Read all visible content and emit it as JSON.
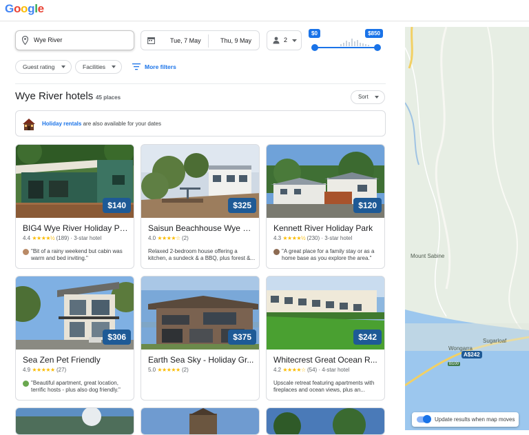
{
  "brand": {
    "logo_letters": [
      "G",
      "o",
      "o",
      "g",
      "l",
      "e"
    ]
  },
  "search": {
    "location": "Wye River",
    "check_in": "Tue, 7 May",
    "check_out": "Thu, 9 May",
    "guests": "2",
    "price_min": "$0",
    "price_max": "$850"
  },
  "filters": {
    "guest_rating": "Guest rating",
    "facilities": "Facilities",
    "more_filters": "More filters"
  },
  "results": {
    "title": "Wye River hotels",
    "count": "45 places",
    "sort_label": "Sort"
  },
  "banner": {
    "link": "Holiday rentals",
    "rest": " are also available for your dates"
  },
  "hotels": [
    {
      "name": "BIG4 Wye River Holiday Pa...",
      "rating": "4.4",
      "stars": "★★★★½",
      "reviews": "(189)",
      "type": " · 3-star hotel",
      "price": "$140",
      "desc": "\"Bit of a rainy weekend but cabin was warm and bed inviting.\"",
      "quote": true
    },
    {
      "name": "Saisun Beachhouse Wye Ri...",
      "rating": "4.0",
      "stars": "★★★★☆",
      "reviews": "(2)",
      "type": "",
      "price": "$325",
      "desc": "Relaxed 2-bedroom house offering a kitchen, a sundeck & a BBQ, plus forest &...",
      "quote": false
    },
    {
      "name": "Kennett River Holiday Park",
      "rating": "4.3",
      "stars": "★★★★½",
      "reviews": "(230)",
      "type": " · 3-star hotel",
      "price": "$120",
      "desc": "\"A great place for a family stay or as a home base as you explore the area.\"",
      "quote": true
    },
    {
      "name": "Sea Zen Pet Friendly",
      "rating": "4.9",
      "stars": "★★★★★",
      "reviews": "(27)",
      "type": "",
      "price": "$306",
      "desc": "\"Beautiful apartment, great location, terrific hosts - plus also dog friendly.\"",
      "quote": true
    },
    {
      "name": "Earth Sea Sky - Holiday Gr...",
      "rating": "5.0",
      "stars": "★★★★★",
      "reviews": "(2)",
      "type": "",
      "price": "$375",
      "desc": "",
      "quote": false
    },
    {
      "name": "Whitecrest Great Ocean R...",
      "rating": "4.2",
      "stars": "★★★★☆",
      "reviews": "(54)",
      "type": " · 4-star hotel",
      "price": "$242",
      "desc": "Upscale retreat featuring apartments with fireplaces and ocean views, plus an...",
      "quote": false
    }
  ],
  "map": {
    "places": [
      "Mount Sabine",
      "Wongarra",
      "Sugarloaf"
    ],
    "price_tag": "A$242",
    "road": "B100",
    "toggle_label": "Update results when map moves"
  },
  "colors": {
    "accent": "#1a73e8",
    "price_badge": "#1e5a96",
    "star": "#fbbc04"
  }
}
